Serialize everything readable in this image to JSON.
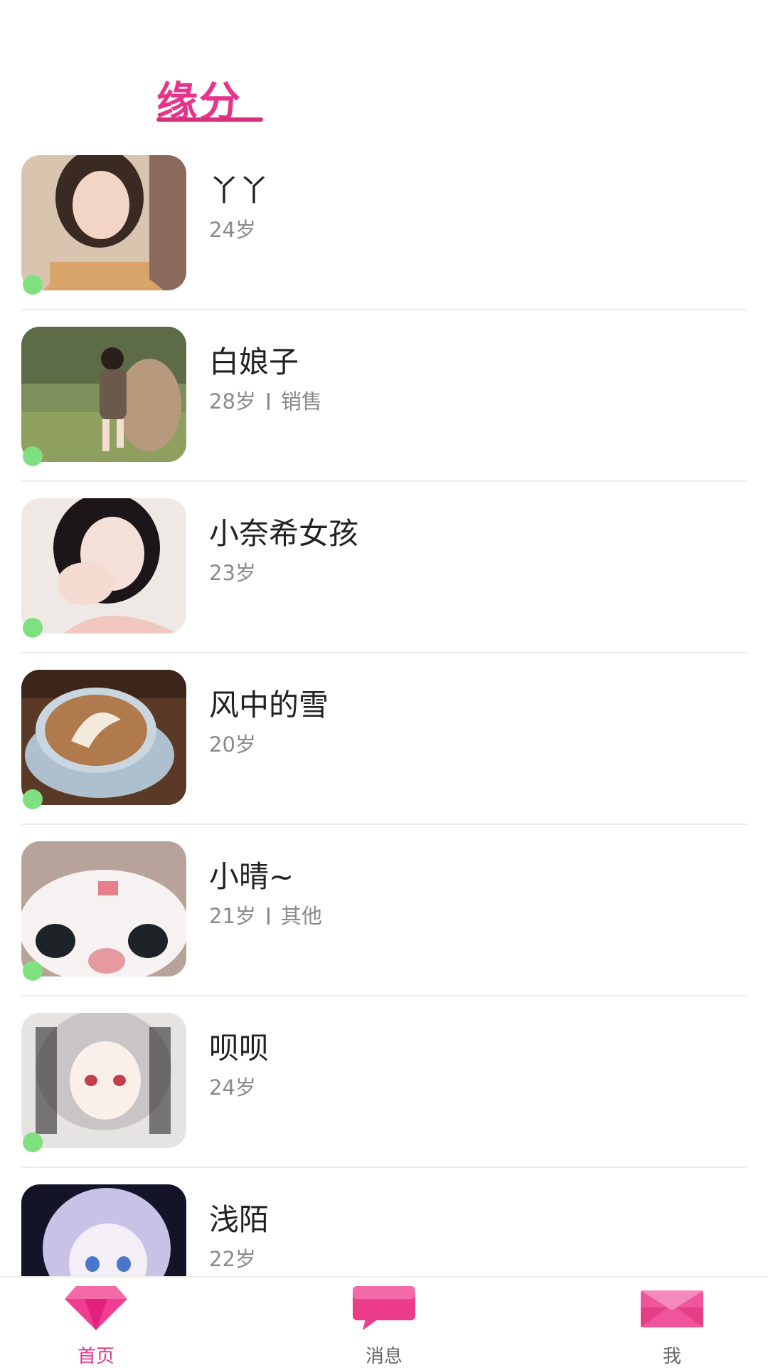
{
  "header": {
    "title": "缘分"
  },
  "accent_color": "#e8338a",
  "online_color": "#7fe07f",
  "users": [
    {
      "name": "丫丫",
      "age": "24岁",
      "job": "",
      "avatar": "photo-woman-sweater",
      "online": true
    },
    {
      "name": "白娘子",
      "age": "28岁",
      "job": "销售",
      "avatar": "photo-woman-outdoor-rock",
      "online": true
    },
    {
      "name": "小奈希女孩",
      "age": "23岁",
      "job": "",
      "avatar": "photo-woman-lying",
      "online": true
    },
    {
      "name": "风中的雪",
      "age": "20岁",
      "job": "",
      "avatar": "photo-latte-art-cup",
      "online": true
    },
    {
      "name": "小晴~",
      "age": "21岁",
      "job": "其他",
      "avatar": "photo-white-cat-closeup",
      "online": true
    },
    {
      "name": "呗呗",
      "age": "24岁",
      "job": "",
      "avatar": "anime-girl-white-hair",
      "online": true
    },
    {
      "name": "浅陌",
      "age": "22岁",
      "job": "",
      "avatar": "anime-girl-lavender-hair",
      "online": false
    }
  ],
  "tabbar": {
    "home": {
      "label": "首页",
      "icon": "diamond-icon"
    },
    "messages": {
      "label": "消息",
      "icon": "chat-bubble-icon"
    },
    "me": {
      "label": "我",
      "icon": "envelope-icon"
    }
  }
}
